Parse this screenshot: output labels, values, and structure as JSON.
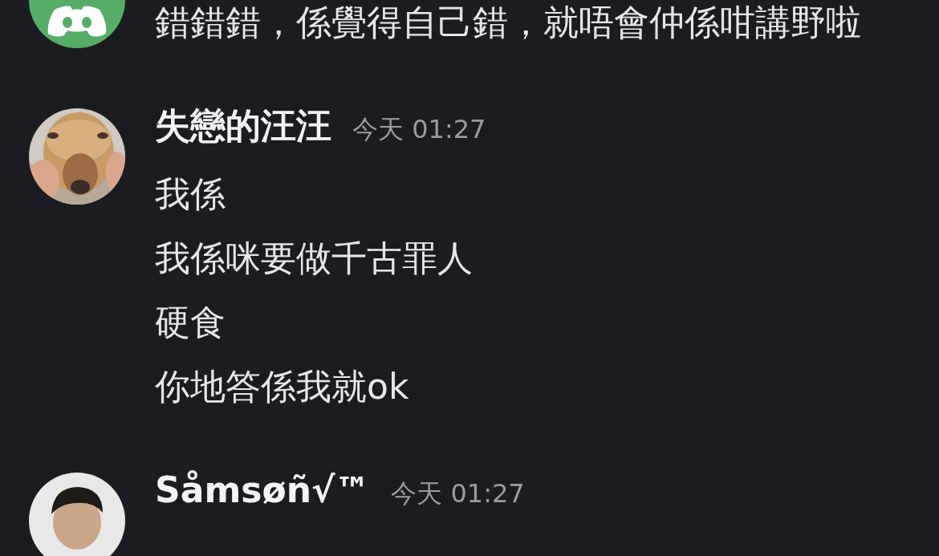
{
  "messages": [
    {
      "avatar": {
        "kind": "logo"
      },
      "lines": [
        "錯錯錯，係覺得自己錯，就唔會仲係咁講野啦"
      ]
    },
    {
      "author": "失戀的汪汪",
      "time": "今天 01:27",
      "lines": [
        "我係",
        "我係咪要做千古罪人",
        "硬食",
        "你地答係我就ok"
      ]
    },
    {
      "avatar": {
        "kind": "person"
      },
      "author": "Såmsøñ√™",
      "time": "今天 01:27"
    }
  ]
}
